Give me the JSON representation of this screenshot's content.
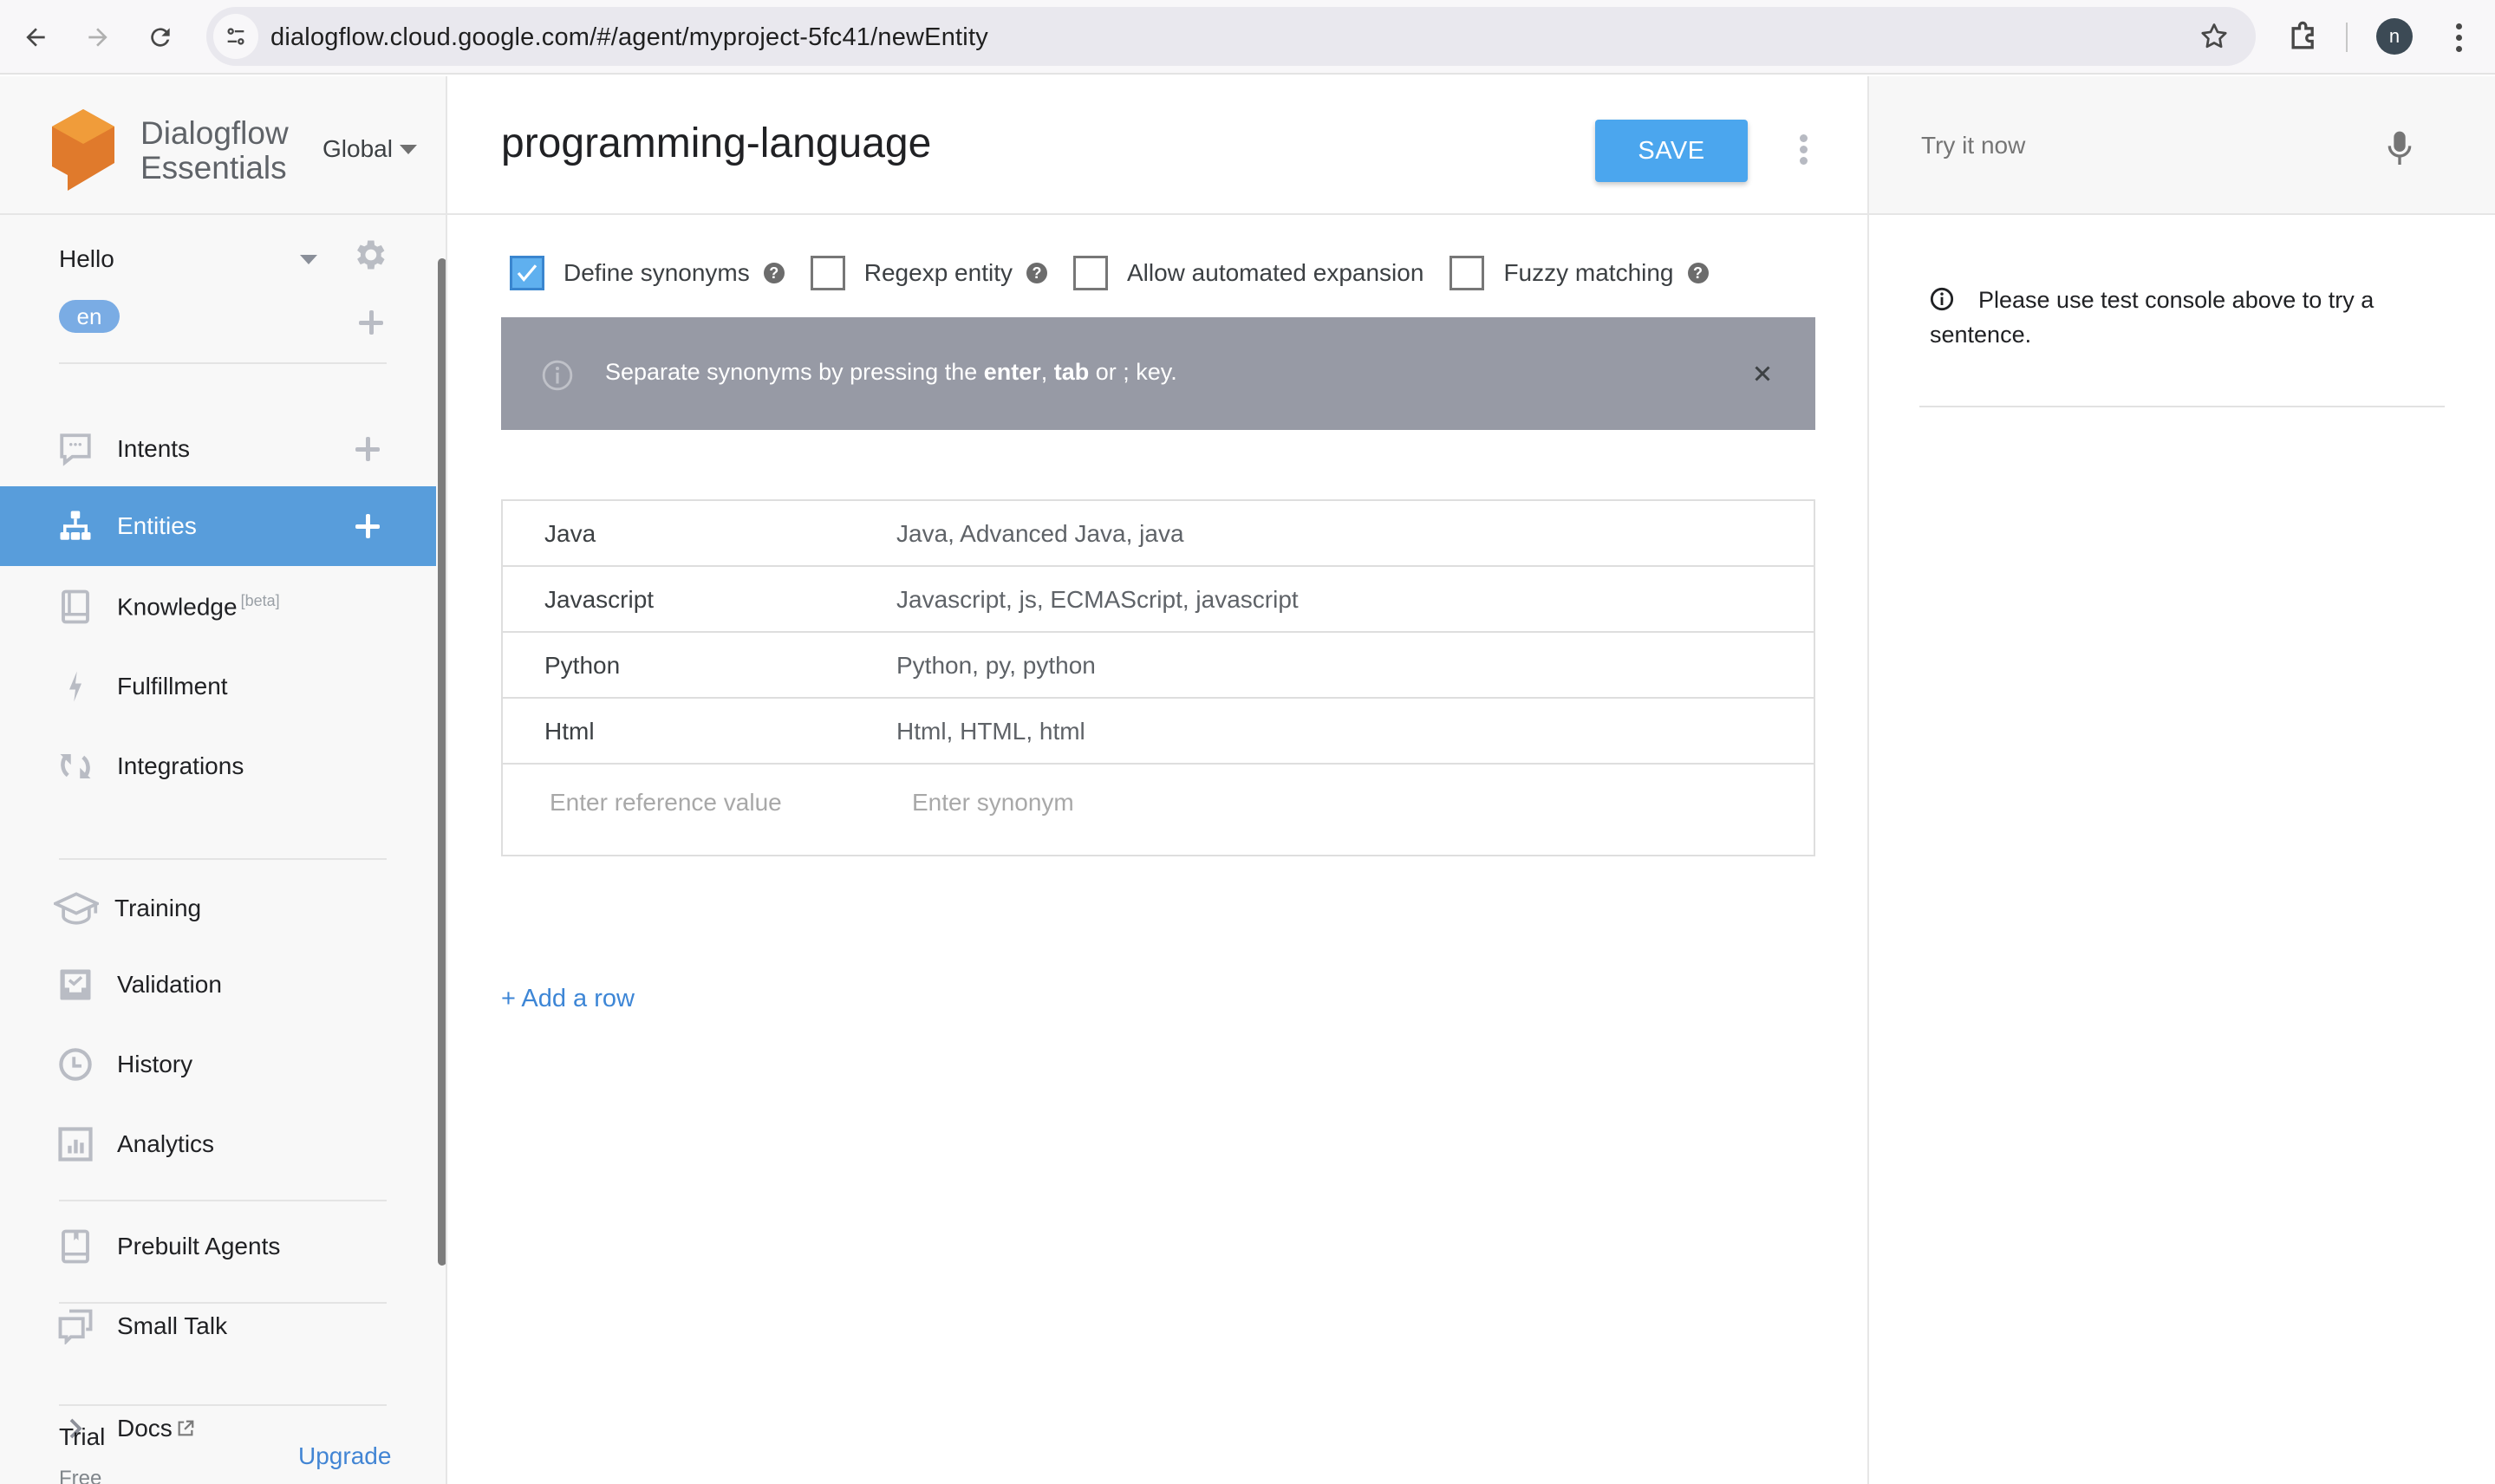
{
  "browser": {
    "url": "dialogflow.cloud.google.com/#/agent/myproject-5fc41/newEntity",
    "profile_initial": "n",
    "icons": [
      "back-icon",
      "forward-icon",
      "reload-icon",
      "site-info-icon",
      "bookmark-star-icon",
      "extensions-icon",
      "profile-avatar",
      "kebab-menu-icon"
    ]
  },
  "sidebar": {
    "brand_line1": "Dialogflow",
    "brand_line2": "Essentials",
    "region": "Global",
    "agent_name": "Hello",
    "language": "en",
    "items": [
      {
        "label": "Intents",
        "icon": "intents-icon",
        "has_add": true,
        "active": false
      },
      {
        "label": "Entities",
        "icon": "entities-icon",
        "has_add": true,
        "active": true
      },
      {
        "label": "Knowledge",
        "badge": "[beta]",
        "icon": "knowledge-icon",
        "has_add": false,
        "active": false
      },
      {
        "label": "Fulfillment",
        "icon": "fulfillment-icon",
        "has_add": false,
        "active": false
      },
      {
        "label": "Integrations",
        "icon": "integrations-icon",
        "has_add": false,
        "active": false
      },
      {
        "label": "Training",
        "icon": "training-icon",
        "has_add": false,
        "active": false
      },
      {
        "label": "Validation",
        "icon": "validation-icon",
        "has_add": false,
        "active": false
      },
      {
        "label": "History",
        "icon": "history-icon",
        "has_add": false,
        "active": false
      },
      {
        "label": "Analytics",
        "icon": "analytics-icon",
        "has_add": false,
        "active": false
      },
      {
        "label": "Prebuilt Agents",
        "icon": "prebuilt-agents-icon",
        "has_add": false,
        "active": false
      },
      {
        "label": "Small Talk",
        "icon": "small-talk-icon",
        "has_add": false,
        "active": false
      },
      {
        "label": "Docs",
        "icon": "chevron-right-icon",
        "external": true,
        "has_add": false,
        "active": false
      }
    ],
    "plan": "Trial",
    "plan_tier": "Free",
    "upgrade_label": "Upgrade"
  },
  "entity": {
    "title": "programming-language",
    "save_label": "SAVE",
    "options": [
      {
        "label": "Define synonyms",
        "checked": true,
        "help": true
      },
      {
        "label": "Regexp entity",
        "checked": false,
        "help": true
      },
      {
        "label": "Allow automated expansion",
        "checked": false,
        "help": false
      },
      {
        "label": "Fuzzy matching",
        "checked": false,
        "help": true
      }
    ],
    "banner": {
      "prefix": "Separate synonyms by pressing the ",
      "key1": "enter",
      "sep": ", ",
      "key2": "tab",
      "suffix": " or ; key."
    },
    "rows": [
      {
        "reference": "Java",
        "synonyms": "Java, Advanced Java, java"
      },
      {
        "reference": "Javascript",
        "synonyms": "Javascript, js, ECMAScript, javascript"
      },
      {
        "reference": "Python",
        "synonyms": "Python, py, python"
      },
      {
        "reference": "Html",
        "synonyms": "Html, HTML, html"
      }
    ],
    "new_row": {
      "reference_placeholder": "Enter reference value",
      "synonym_placeholder": "Enter synonym"
    },
    "add_row_label": "+ Add a row"
  },
  "console": {
    "input_placeholder": "Try it now",
    "note": "Please use test console above to try a sentence."
  },
  "colors": {
    "accent": "#4ba6ee",
    "active_nav": "#589ddb",
    "link": "#3d86d6",
    "banner": "#979aa5",
    "logo_orange": "#e07a2c"
  }
}
